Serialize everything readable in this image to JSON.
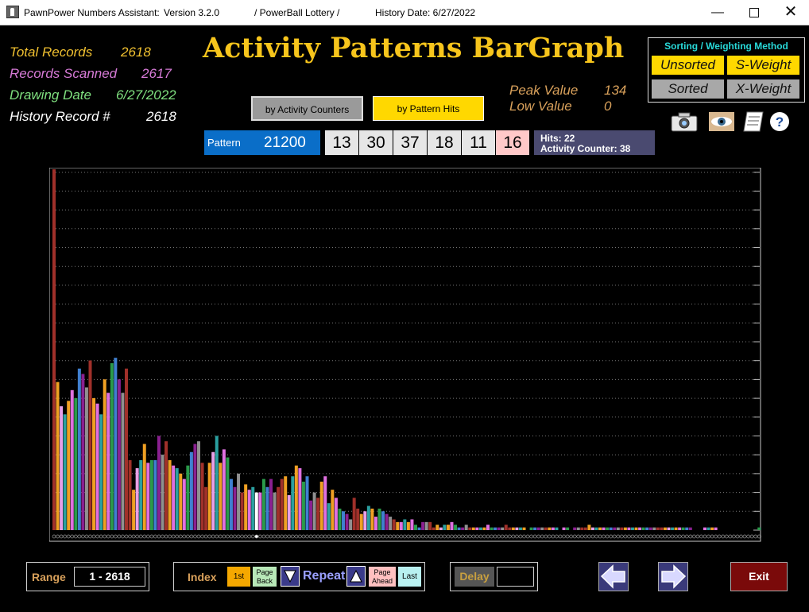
{
  "titlebar": {
    "app_name": "PawnPower Numbers Assistant:",
    "version": "Version 3.2.0",
    "game": "/ PowerBall Lottery /",
    "history_date": "History Date:  6/27/2022"
  },
  "stats": {
    "total_records_label": "Total Records",
    "total_records_value": "2618",
    "records_scanned_label": "Records Scanned",
    "records_scanned_value": "2617",
    "drawing_date_label": "Drawing Date",
    "drawing_date_value": "6/27/2022",
    "history_record_label": "History Record #",
    "history_record_value": "2618"
  },
  "title": "Activity Patterns BarGraph",
  "mode_buttons": {
    "activity_counters": "by Activity Counters",
    "pattern_hits": "by Pattern Hits"
  },
  "peak": {
    "peak_label": "Peak Value",
    "peak_value": "134",
    "low_label": "Low Value",
    "low_value": "0"
  },
  "sorting": {
    "header": "Sorting / Weighting Method",
    "unsorted": "Unsorted",
    "s_weight": "S-Weight",
    "sorted": "Sorted",
    "x_weight": "X-Weight"
  },
  "icons": [
    "camera-icon",
    "eye-icon",
    "notepad-icon",
    "help-icon"
  ],
  "pattern": {
    "label": "Pattern",
    "value": "21200",
    "numbers": [
      "13",
      "30",
      "37",
      "18",
      "11",
      "16"
    ],
    "hits_text": "Hits: 22",
    "activity_counter_text": "Activity Counter: 38"
  },
  "colors": {
    "title": "#f7c51c",
    "active_mode": "#ffd800",
    "pattern_blue": "#0a6ec8",
    "powerball_cell": "#ffc8c8",
    "exit": "#7a0a0a"
  },
  "chart_data": {
    "type": "bar",
    "ylim": [
      0,
      134
    ],
    "grid": true,
    "selected_index": 56,
    "values": [
      134,
      55,
      46,
      43,
      48,
      52,
      49,
      60,
      58,
      53,
      63,
      49,
      47,
      43,
      56,
      51,
      62,
      64,
      56,
      51,
      60,
      26,
      15,
      23,
      26,
      32,
      25,
      26,
      26,
      35,
      28,
      33,
      26,
      24,
      23,
      21,
      19,
      24,
      29,
      32,
      33,
      25,
      16,
      25,
      29,
      35,
      25,
      30,
      27,
      19,
      16,
      21,
      14,
      17,
      15,
      16,
      14,
      14,
      19,
      16,
      19,
      14,
      16,
      19,
      20,
      13,
      20,
      24,
      23,
      18,
      20,
      11,
      14,
      12,
      18,
      20,
      10,
      15,
      12,
      8,
      7,
      6,
      4,
      12,
      8,
      6,
      7,
      9,
      8,
      5,
      8,
      7,
      6,
      5,
      4,
      3,
      3,
      4,
      3,
      4,
      2,
      1,
      3,
      3,
      3,
      1,
      2,
      1,
      2,
      2,
      3,
      2,
      1,
      1,
      2,
      1,
      1,
      1,
      1,
      1,
      2,
      1,
      1,
      1,
      1,
      2,
      1,
      1,
      1,
      1,
      1,
      0,
      1,
      1,
      1,
      1,
      1,
      1,
      1,
      1,
      0,
      1,
      1,
      0,
      1,
      1,
      1,
      1,
      2,
      1,
      1,
      1,
      1,
      1,
      1,
      1,
      1,
      1,
      1,
      1,
      1,
      1,
      1,
      1,
      1,
      1,
      1,
      1,
      1,
      1,
      1,
      1,
      1,
      1,
      1,
      1,
      1,
      0,
      0,
      0,
      1,
      1,
      1,
      1,
      0,
      0,
      0,
      0,
      0,
      0,
      0,
      0,
      0,
      0,
      0,
      1,
      1,
      1
    ],
    "bar_colors": [
      "#a0302a",
      "#f0a023",
      "#e8a0e8",
      "#2aa0a0",
      "#f0a023",
      "#e070e0",
      "#2a9a4a",
      "#4080d0",
      "#8a2090",
      "#909090",
      "#a0302a",
      "#f0a023",
      "#e070e0",
      "#2aa0a0",
      "#f0a023",
      "#e070e0",
      "#2a9a4a",
      "#4080d0",
      "#8a2090",
      "#909090",
      "#a0302a"
    ]
  },
  "bottom": {
    "range_label": "Range",
    "range_value": "1 - 2618",
    "index_label": "Index",
    "first": "1st",
    "page_back_1": "Page",
    "page_back_2": "Back",
    "repeat": "Repeat",
    "page_ahead_1": "Page",
    "page_ahead_2": "Ahead",
    "last": "Last",
    "delay_label": "Delay",
    "exit": "Exit"
  }
}
